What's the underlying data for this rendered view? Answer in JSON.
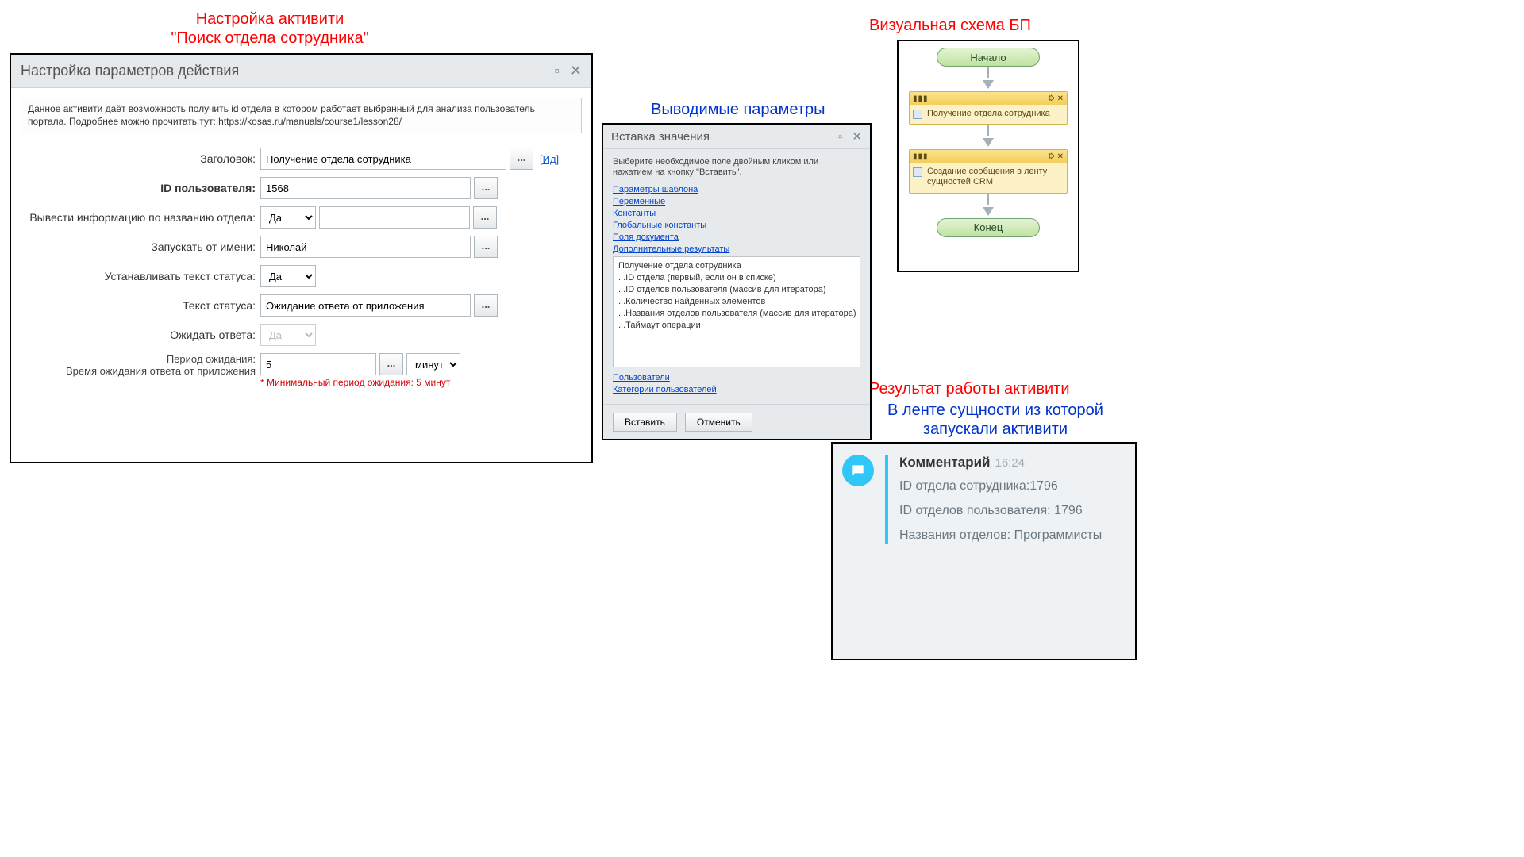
{
  "callouts": {
    "activity_title": "Настройка активити\n\"Поиск отдела сотрудника\"",
    "output_params": "Выводимые параметры",
    "bp_visual": "Визуальная схема БП",
    "result_title": "Результат работы активити",
    "result_sub": "В ленте сущности из которой\nзапускали активити"
  },
  "dlg1": {
    "title": "Настройка параметров действия",
    "description": "Данное активити даёт возможность получить id отдела в котором работает выбранный для анализа пользователь портала. Подробнее можно прочитать тут: https://kosas.ru/manuals/course1/lesson28/",
    "link_id": "[Ид]",
    "labels": {
      "zagolovok": "Заголовок:",
      "id_user": "ID пользователя:",
      "show_dept_name": "Вывести информацию по названию отдела:",
      "run_as": "Запускать от имени:",
      "set_status": "Устанавливать текст статуса:",
      "status_text": "Текст статуса:",
      "wait_answer": "Ожидать ответа:",
      "wait_period": "Период ожидания:",
      "wait_sub": "Время ожидания ответа от приложения"
    },
    "values": {
      "zagolovok": "Получение отдела сотрудника",
      "id_user": "1568",
      "show_dept_name": "Да",
      "run_as": "Николай ",
      "set_status": "Да",
      "status_text": "Ожидание ответа от приложения",
      "wait_answer": "Да",
      "wait_period_value": "5",
      "wait_period_unit": "минут"
    },
    "hint": "* Минимальный период ожидания: 5 минут"
  },
  "dlg2": {
    "title": "Вставка значения",
    "hint": "Выберите необходимое поле двойным кликом или нажатием на кнопку \"Вставить\".",
    "links_top": [
      "Параметры шаблона",
      "Переменные",
      "Константы",
      "Глобальные константы",
      "Поля документа",
      "Дополнительные результаты"
    ],
    "results": [
      "Получение отдела сотрудника",
      "...ID отдела (первый, если он в списке)",
      "...ID отделов пользователя (массив для итератора)",
      "...Количество найденных элементов",
      "...Названия отделов пользователя (массив для итератора)",
      "...Таймаут операции"
    ],
    "links_bottom": [
      "Пользователи",
      "Категории пользователей"
    ],
    "btn_insert": "Вставить",
    "btn_cancel": "Отменить"
  },
  "bp": {
    "start": "Начало",
    "act1": "Получение отдела сотрудника",
    "act2": "Создание сообщения в ленту сущностей CRM",
    "end": "Конец"
  },
  "feed": {
    "header": "Комментарий",
    "time": "16:24",
    "line1": "ID отдела сотрудника:1796",
    "line2": "ID отделов пользователя: 1796",
    "line3": "Названия отделов: Программисты"
  }
}
